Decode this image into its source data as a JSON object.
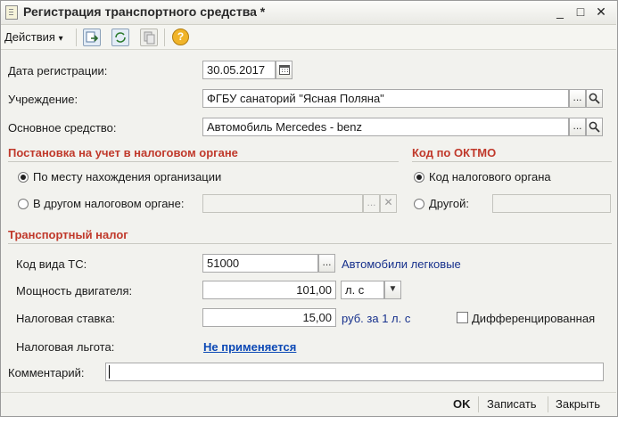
{
  "window": {
    "title": "Регистрация транспортного средства *",
    "min_icon": "_",
    "max_icon": "□",
    "close_icon": "✕"
  },
  "toolbar": {
    "actions_label": "Действия",
    "actions_arrow": "▾",
    "help_glyph": "?"
  },
  "form": {
    "reg_date": {
      "label": "Дата регистрации:",
      "value": "30.05.2017"
    },
    "institution": {
      "label": "Учреждение:",
      "value": "ФГБУ санаторий \"Ясная Поляна\""
    },
    "asset": {
      "label": "Основное средство:",
      "value": "Автомобиль Mercedes - benz"
    },
    "ellipsis": "...",
    "clear_glyph": "✕"
  },
  "tax_registration": {
    "title": "Постановка на учет в налоговом органе",
    "option_org_location": "По месту нахождения организации",
    "option_other_office": "В другом налоговом органе:"
  },
  "oktmo": {
    "title": "Код по ОКТМО",
    "option_tax_office_code": "Код налогового органа",
    "option_other": "Другой:"
  },
  "transport_tax": {
    "title": "Транспортный налог",
    "vehicle_code": {
      "label": "Код вида ТС:",
      "value": "51000",
      "description": "Автомобили легковые"
    },
    "engine_power": {
      "label": "Мощность двигателя:",
      "value": "101,00",
      "unit": "л. с",
      "unit_arrow": "▼"
    },
    "tax_rate": {
      "label": "Налоговая ставка:",
      "value": "15,00",
      "unit": "руб. за 1 л. с"
    },
    "differentiated": {
      "label": "Дифференцированная",
      "checked": false
    },
    "tax_benefit": {
      "label": "Налоговая льгота:",
      "value": "Не применяется"
    }
  },
  "comment": {
    "label": "Комментарий:",
    "value": ""
  },
  "footer": {
    "ok": "OK",
    "save": "Записать",
    "close": "Закрыть"
  }
}
